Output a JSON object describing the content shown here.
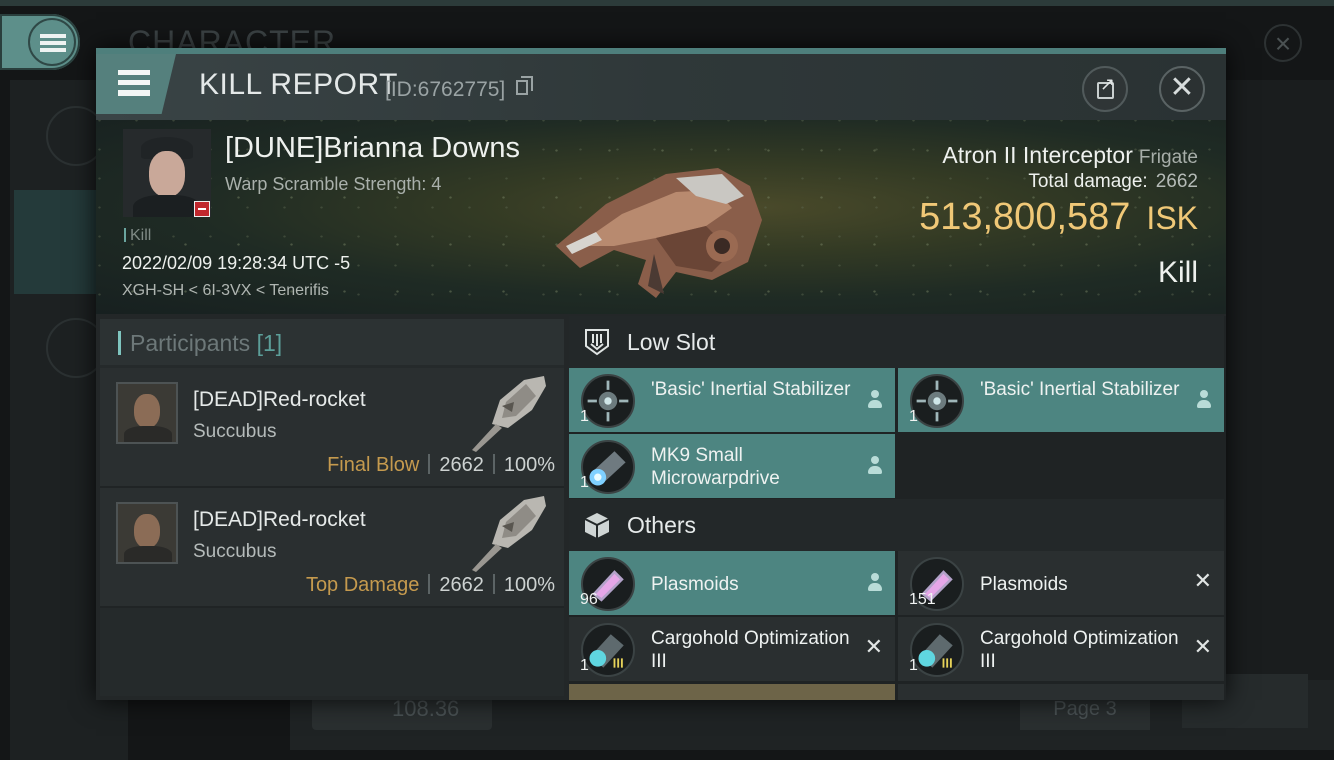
{
  "background": {
    "title": "CHARACTER",
    "bottom_value": "108.36",
    "page_label": "Page 3"
  },
  "header": {
    "title": "KILL REPORT",
    "id_text": "[ID:6762775]"
  },
  "victim": {
    "name": "[DUNE]Brianna Downs",
    "subtitle": "Warp Scramble Strength: 4",
    "tag": "Kill",
    "datetime": "2022/02/09 19:28:34 UTC -5",
    "location": "XGH-SH < 6I-3VX < Tenerifis",
    "ship_name": "Atron II Interceptor",
    "ship_class": "Frigate",
    "total_damage_label": "Total damage:",
    "total_damage": "2662",
    "isk_value": "513,800,587",
    "isk_unit": "ISK",
    "result": "Kill"
  },
  "participants": {
    "title": "Participants",
    "count": "[1]",
    "rows": [
      {
        "name": "[DEAD]Red-rocket",
        "ship": "Succubus",
        "role": "Final Blow",
        "damage": "2662",
        "percent": "100%"
      },
      {
        "name": "[DEAD]Red-rocket",
        "ship": "Succubus",
        "role": "Top Damage",
        "damage": "2662",
        "percent": "100%"
      }
    ]
  },
  "items": {
    "low_slot": {
      "title": "Low Slot",
      "cells": [
        {
          "name": "'Basic' Inertial Stabilizer",
          "qty": "1",
          "status": "pilot-icon"
        },
        {
          "name": "'Basic' Inertial Stabilizer",
          "qty": "1",
          "status": "pilot-icon"
        },
        {
          "name": "MK9 Small Microwarpdrive",
          "qty": "1",
          "status": "pilot-icon"
        }
      ]
    },
    "others": {
      "title": "Others",
      "cells": [
        {
          "name": "Plasmoids",
          "qty": "96",
          "status": "pilot-icon"
        },
        {
          "name": "Plasmoids",
          "qty": "151",
          "status": "close-icon"
        },
        {
          "name": "Cargohold Optimization III",
          "qty": "1",
          "status": "close-icon"
        },
        {
          "name": "Cargohold Optimization III",
          "qty": "1",
          "status": "close-icon"
        }
      ]
    },
    "status_glyphs": {
      "close": "✕"
    }
  },
  "colors": {
    "accent_teal": "#4d8581",
    "isk_gold": "#f0c877",
    "role_orange": "#c59a4e",
    "loss_badge_red": "#c0272d"
  }
}
